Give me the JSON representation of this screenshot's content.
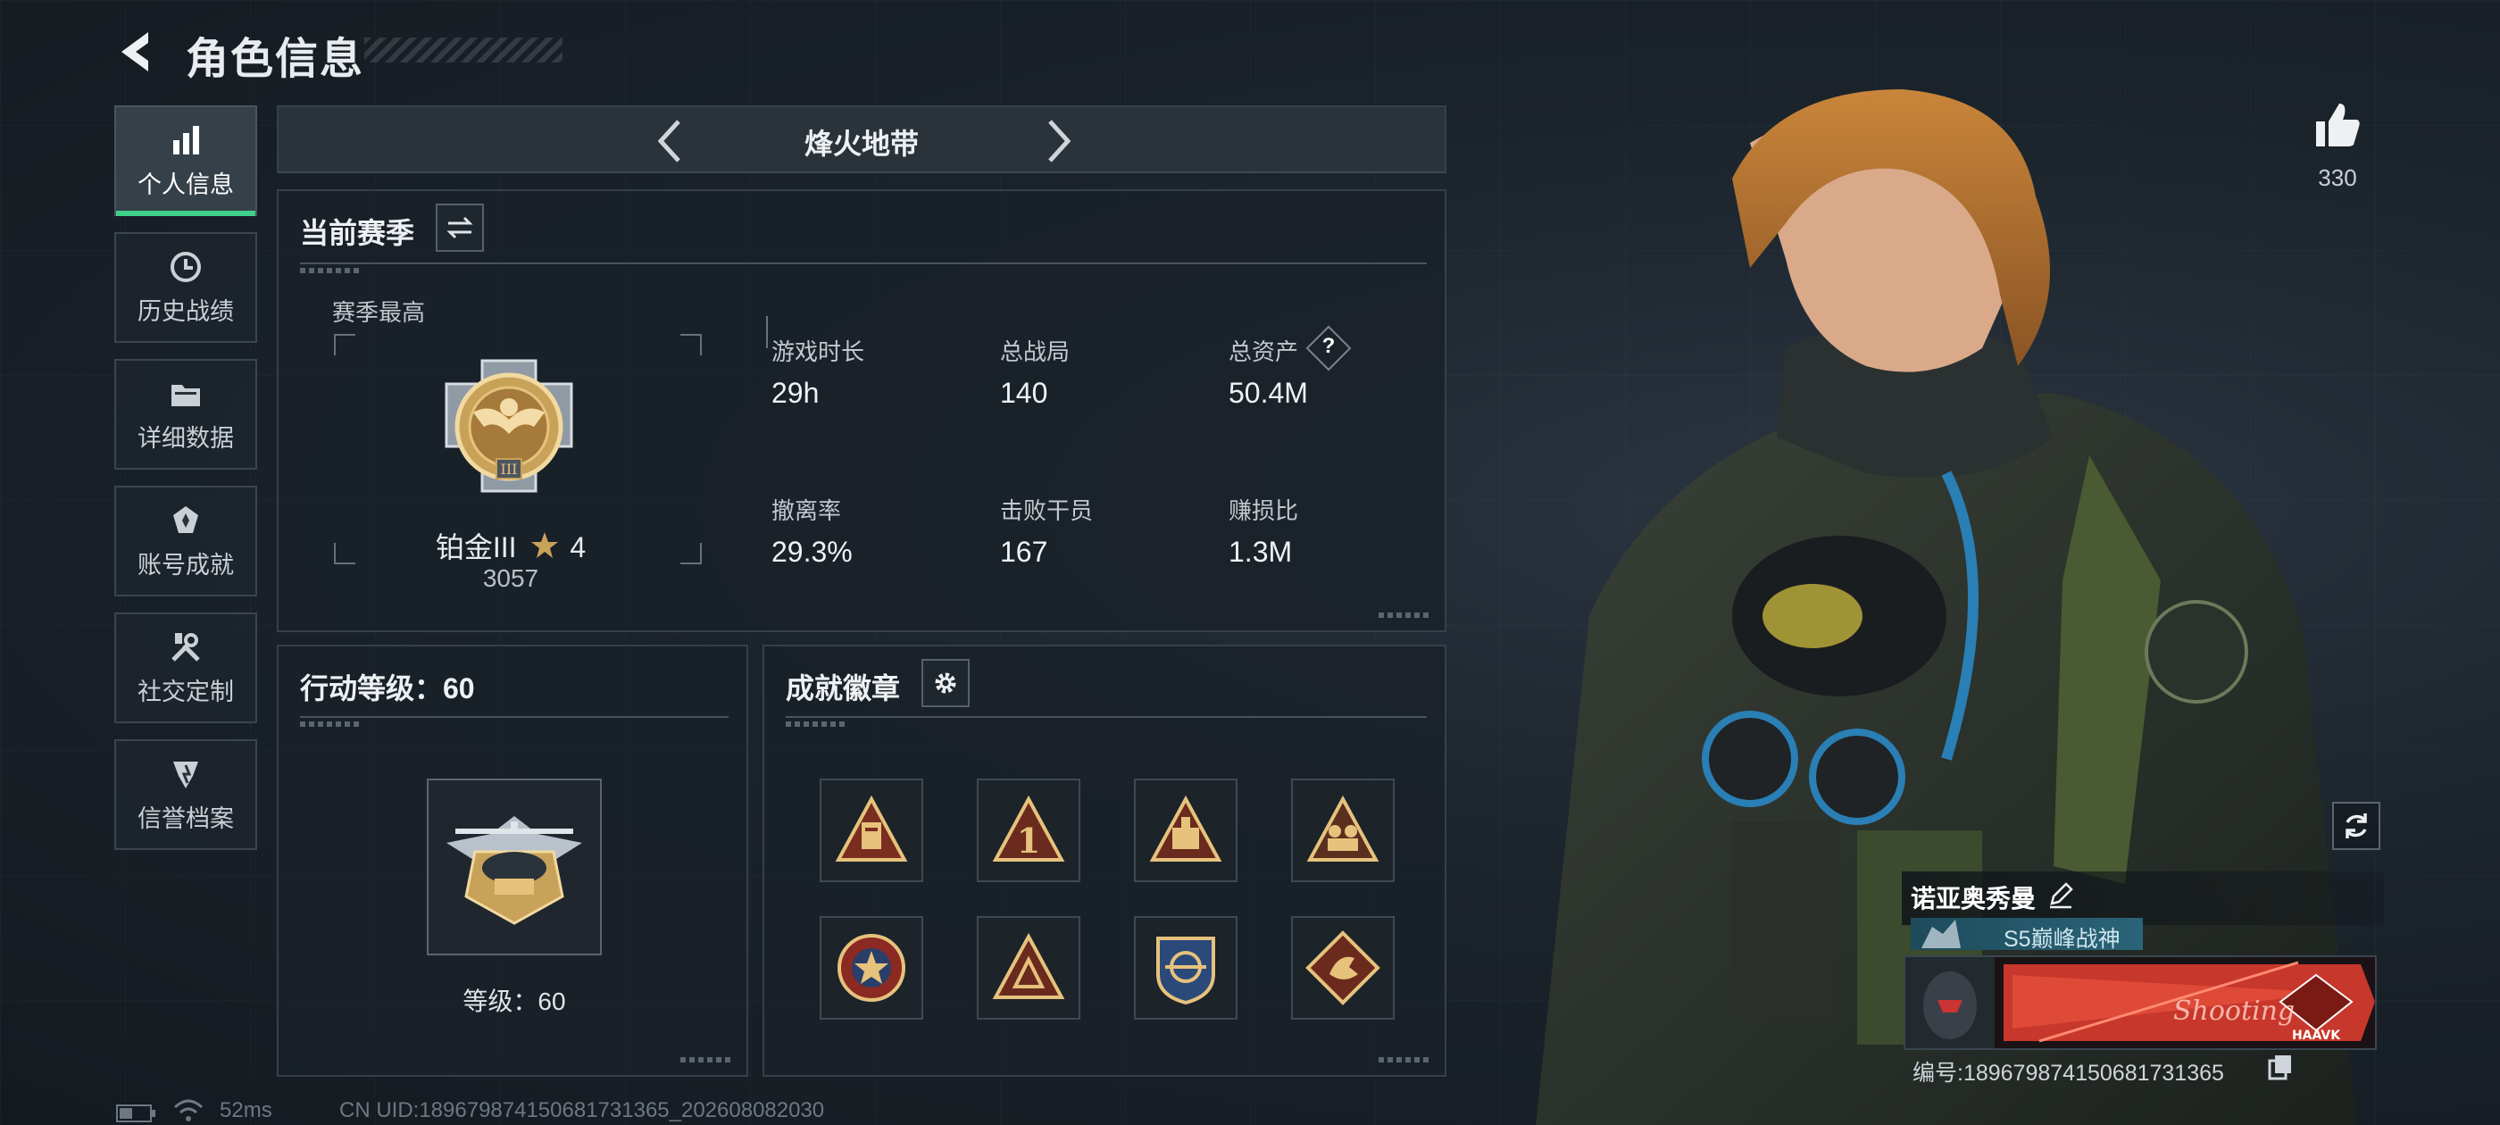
{
  "header": {
    "title": "角色信息",
    "back_icon": "back-arrow-icon"
  },
  "sidebar": {
    "items": [
      {
        "label": "个人信息",
        "icon": "bar-chart-icon",
        "active": true
      },
      {
        "label": "历史战绩",
        "icon": "history-clock-icon",
        "active": false
      },
      {
        "label": "详细数据",
        "icon": "folder-icon",
        "active": false
      },
      {
        "label": "账号成就",
        "icon": "achievement-icon",
        "active": false
      },
      {
        "label": "社交定制",
        "icon": "tools-icon",
        "active": false
      },
      {
        "label": "信誉档案",
        "icon": "reputation-icon",
        "active": false
      }
    ]
  },
  "mode_tabs": {
    "current": "烽火地带"
  },
  "season": {
    "title": "当前赛季",
    "best_label": "赛季最高",
    "rank_name": "铂金III",
    "rank_stars": "4",
    "rank_score": "3057",
    "stats": [
      {
        "label": "游戏时长",
        "value": "29h"
      },
      {
        "label": "总战局",
        "value": "140"
      },
      {
        "label": "总资产",
        "value": "50.4M",
        "help": "?"
      },
      {
        "label": "撤离率",
        "value": "29.3%"
      },
      {
        "label": "击败干员",
        "value": "167"
      },
      {
        "label": "赚损比",
        "value": "1.3M"
      }
    ]
  },
  "action_level": {
    "title": "行动等级：60",
    "level_text": "等级：60"
  },
  "achievements": {
    "title": "成就徽章",
    "badges": [
      "badge-1-icon",
      "badge-2-icon",
      "badge-3-icon",
      "badge-4-icon",
      "badge-5-icon",
      "badge-6-icon",
      "badge-7-icon",
      "badge-8-icon"
    ]
  },
  "likes": {
    "count": "330",
    "icon": "thumbs-up-icon"
  },
  "player": {
    "name": "诺亚奥秀曼",
    "title_tag": "S5巅峰战神",
    "card_text": "Shooting",
    "card_brand": "HAAVK",
    "id_code": "编号:18967987415068173​1365"
  },
  "status_bar": {
    "ping": "52ms",
    "uid": "CN UID:18967987415068173​1365_202608082030"
  },
  "colors": {
    "accent_green": "#3fd18a",
    "gold": "#c9a25a",
    "panel_bg": "#1a2128"
  }
}
